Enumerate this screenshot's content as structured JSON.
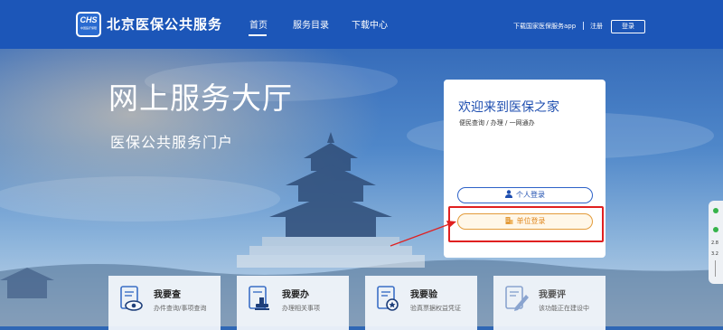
{
  "header": {
    "logo_text": "CHS",
    "logo_subtext": "中国医疗保障",
    "site_title": "北京医保公共服务",
    "nav": {
      "home": "首页",
      "catalog": "服务目录",
      "download": "下载中心"
    },
    "download_app": "下载国家医保服务app",
    "separator": "|",
    "register": "注册",
    "login": "登录"
  },
  "hero": {
    "title": "网上服务大厅",
    "subtitle": "医保公共服务门户"
  },
  "login_card": {
    "title": "欢迎来到医保之家",
    "subtitle": "便民查询 / 办理 / 一网通办",
    "personal_login": "个人登录",
    "unit_login": "单位登录"
  },
  "tiles": [
    {
      "title": "我要查",
      "desc": "办件查询/事项查询",
      "icon": "eye-document-icon"
    },
    {
      "title": "我要办",
      "desc": "办理相关事项",
      "icon": "stamp-icon"
    },
    {
      "title": "我要验",
      "desc": "验真票据权益凭证",
      "icon": "verify-document-icon"
    },
    {
      "title": "我要评",
      "desc": "该功能正在建设中",
      "icon": "pencil-document-icon"
    }
  ],
  "side_widget": {
    "value1": "2.8",
    "value2": "3.2"
  },
  "colors": {
    "header_bg": "#1c56b8",
    "primary_blue": "#2d62c8",
    "unit_orange": "#e08a22",
    "annotation_red": "#e02020"
  }
}
